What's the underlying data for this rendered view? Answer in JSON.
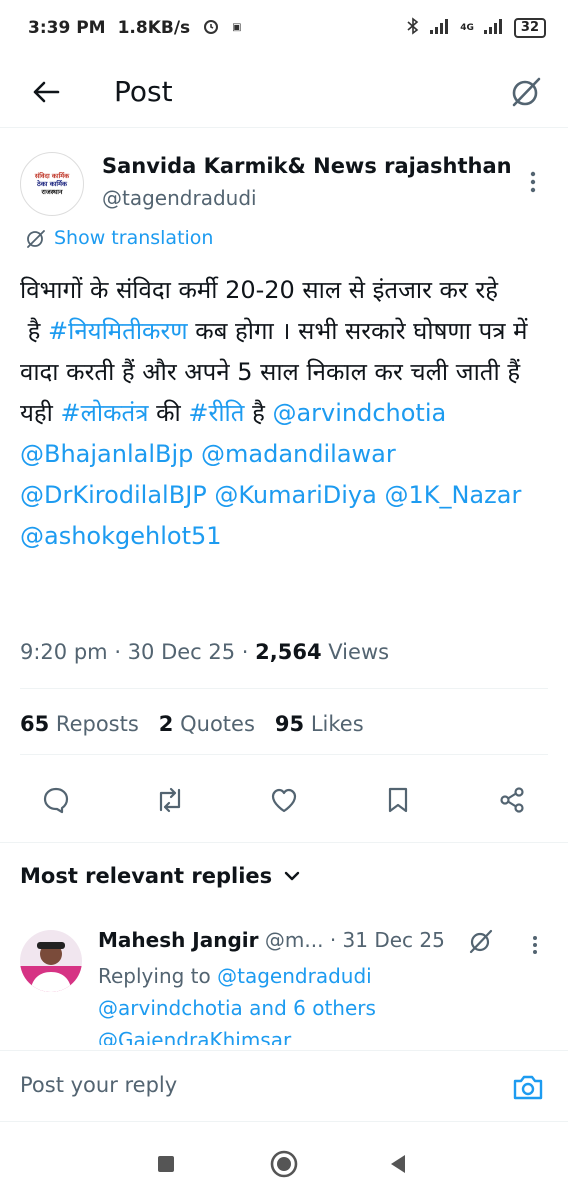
{
  "status_bar": {
    "time": "3:39 PM",
    "speed": "1.8KB/s",
    "network": "4G",
    "battery": "32"
  },
  "header": {
    "title": "Post"
  },
  "tweet": {
    "author_name": "Sanvida Karmik& News rajashthan",
    "author_handle": "@tagendradudi",
    "avatar_text": [
      "संविदा कार्मिक",
      "ठेका कार्मिक",
      "राजस्थान"
    ],
    "show_translation": "Show translation",
    "text": {
      "p1": "विभागों के संविदा कर्मी 20-20 साल से इंतजार कर रहे",
      "p2a": "है ",
      "tag1": "#नियमितीकरण",
      "p2b": " कब होगा । सभी सरकारे घोषणा पत्र में वादा करती हैं और अपने 5 साल निकाल कर चली जाती हैं यही ",
      "tag2": "#लोकतंत्र",
      "p2c": " की ",
      "tag3": "#रीति",
      "p2d": " है ",
      "m1": "@arvindchotia",
      "m2": "@BhajanlalBjp",
      "m3": "@madandilawar",
      "m4": "@DrKirodilalBJP",
      "m5": "@KumariDiya",
      "m6": "@1K_Nazar",
      "m7": "@ashokgehlot51"
    },
    "time": "9:20 pm",
    "date": "30 Dec 25",
    "views": "2,564",
    "views_label": "Views",
    "reposts": "65",
    "reposts_label": "Reposts",
    "quotes": "2",
    "quotes_label": "Quotes",
    "likes": "95",
    "likes_label": "Likes"
  },
  "replies": {
    "heading": "Most relevant replies",
    "items": [
      {
        "name": "Mahesh Jangir",
        "handle": "@m...",
        "date": "· 31 Dec 25",
        "replying_prefix": "Replying to",
        "replying_handle": "@tagendradudi",
        "replying_more": "@arvindchotia and 6 others",
        "preview": "@GajendraKhimsar"
      }
    ]
  },
  "composer": {
    "placeholder": "Post your reply"
  },
  "colors": {
    "accent": "#1d9bf0",
    "text": "#0f1419",
    "muted": "#536471"
  }
}
